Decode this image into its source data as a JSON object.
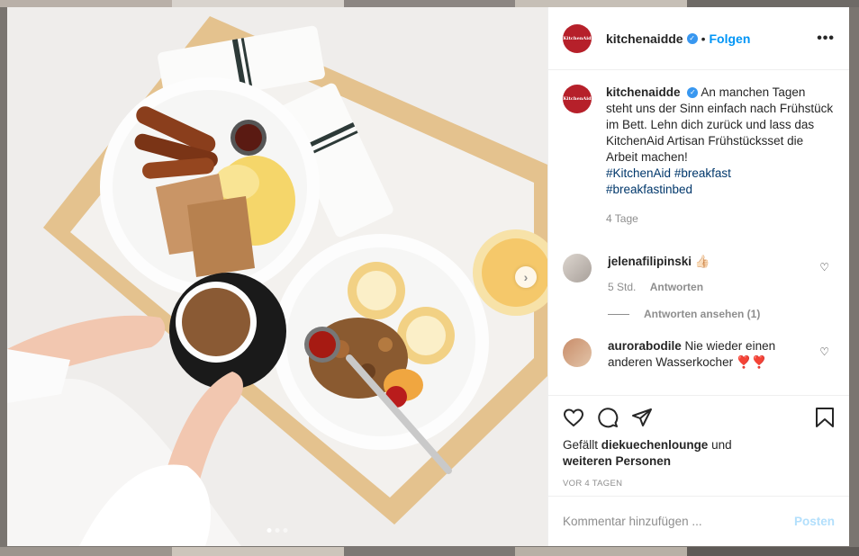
{
  "post": {
    "username": "kitchenaidde",
    "follow_separator": "•",
    "follow_label": "Folgen",
    "more_label": "•••",
    "avatar_text": "KitchenAid",
    "caption_text": "An manchen Tagen steht uns der Sinn einfach nach Frühstück im Bett. Lehn dich zurück und lass das KitchenAid Artisan Frühstücksset die Arbeit machen!",
    "hashtags": [
      "#KitchenAid",
      "#breakfast",
      "#breakfastinbed"
    ],
    "caption_age": "4 Tage",
    "next_label": "›",
    "carousel_count": 3
  },
  "comments": [
    {
      "username": "jelenafilipinski",
      "text": "👍🏻",
      "time": "5 Std.",
      "reply_label": "Antworten",
      "view_replies": "Antworten ansehen (1)"
    },
    {
      "username": "aurorabodile",
      "text": "Nie wieder einen anderen Wasserkocher ❣️❣️"
    }
  ],
  "likes": {
    "prefix": "Gefällt",
    "user": "diekuechenlounge",
    "conjunction": "und",
    "others": "weiteren Personen"
  },
  "date_label": "VOR 4 TAGEN",
  "add_comment": {
    "placeholder": "Kommentar hinzufügen ...",
    "post_label": "Posten"
  },
  "colors": {
    "accent": "#0095f6",
    "brand": "#b6202a",
    "hashtag": "#00376b"
  },
  "icons": [
    "heart-icon",
    "comment-icon",
    "share-icon",
    "bookmark-icon",
    "verified-icon",
    "more-icon"
  ]
}
